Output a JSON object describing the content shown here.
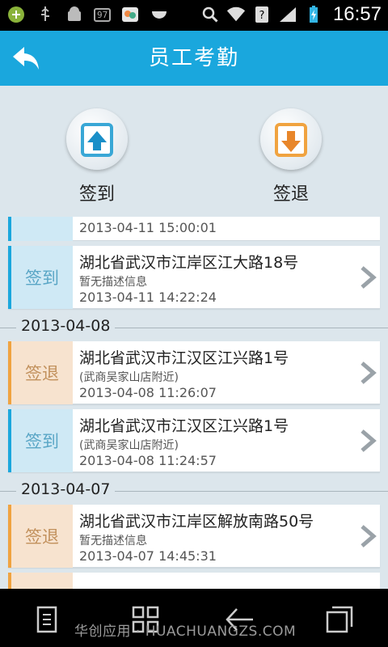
{
  "status_bar": {
    "battery_badge": "97",
    "time": "16:57",
    "icons": [
      "app-icon",
      "usb-icon",
      "android-icon",
      "battery-badge",
      "photo-icon",
      "watermelon-icon",
      "search-icon",
      "wifi-icon",
      "unknown-sim-icon",
      "signal-icon",
      "battery-charging-icon"
    ]
  },
  "header": {
    "title": "员工考勤",
    "back_icon": "back-arrow-icon"
  },
  "actions": {
    "sign_in_label": "签到",
    "sign_out_label": "签退"
  },
  "records": {
    "partial_top_time": "2013-04-11 15:00:01",
    "item1": {
      "type": "签到",
      "address": "湖北省武汉市江岸区江大路18号",
      "description": "暂无描述信息",
      "time": "2013-04-11 14:22:24"
    },
    "date1": "2013-04-08",
    "item2": {
      "type": "签退",
      "address": "湖北省武汉市江汉区江兴路1号",
      "description": "(武商吴家山店附近)",
      "time": "2013-04-08 11:26:07"
    },
    "item3": {
      "type": "签到",
      "address": "湖北省武汉市江汉区江兴路1号",
      "description": "(武商吴家山店附近)",
      "time": "2013-04-08 11:24:57"
    },
    "date2": "2013-04-07",
    "item4": {
      "type": "签退",
      "address": "湖北省武汉市江岸区解放南路50号",
      "description": "暂无描述信息",
      "time": "2013-04-07 14:45:31"
    }
  },
  "nav": {
    "watermark": "华创应用 · HUACHUANGZS.COM"
  },
  "colors": {
    "accent": "#1aa7dd",
    "sign_in_tag_bg": "#cfe9f5",
    "sign_out_tag_bg": "#f7e3cf",
    "sign_out_accent": "#f0a340"
  }
}
